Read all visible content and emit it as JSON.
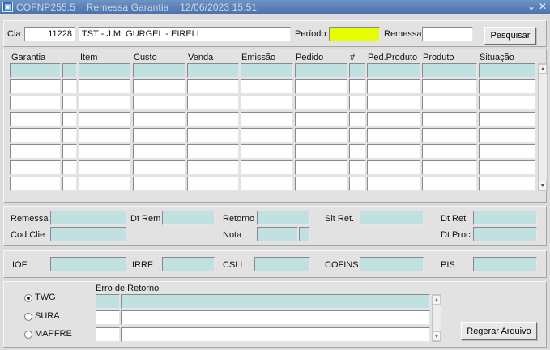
{
  "window": {
    "title": "COFNP255.5    Remessa Garantia    12/06/2023 15:51",
    "minimize_glyph": "⌄",
    "close_glyph": "✕"
  },
  "search": {
    "cia_label": "Cia:",
    "cia_code": "11228",
    "cia_name": "TST - J.M. GURGEL - EIRELI",
    "periodo_label": "Período:",
    "periodo_value": "",
    "remessa_label": "Remessa",
    "remessa_value": "",
    "search_button": "Pesquisar"
  },
  "grid": {
    "columns": [
      "Garantia",
      "Item",
      "Custo",
      "Venda",
      "Emissão",
      "Pedido",
      "#",
      "Ped.Produto",
      "Produto",
      "Situação"
    ],
    "row_count": 8
  },
  "detail": {
    "remessa_label": "Remessa",
    "dt_rem_label": "Dt Rem",
    "retorno_label": "Retorno",
    "sit_ret_label": "Sit Ret.",
    "dt_ret_label": "Dt Ret",
    "cod_clie_label": "Cod Clie",
    "nota_label": "Nota",
    "dt_proc_label": "Dt Proc"
  },
  "taxes": {
    "iof_label": "IOF",
    "irrf_label": "IRRF",
    "csll_label": "CSLL",
    "cofins_label": "COFINS",
    "pis_label": "PIS"
  },
  "bottom": {
    "insurers": [
      {
        "label": "TWG",
        "selected": true
      },
      {
        "label": "SURA",
        "selected": false
      },
      {
        "label": "MAPFRE",
        "selected": false
      }
    ],
    "erro_label": "Erro de Retorno",
    "regerar_button": "Regerar Arquivo"
  },
  "colors": {
    "readonly_fill": "#c1e0e0",
    "highlight_field": "#e5ff00",
    "titlebar": "#5a7fb8"
  }
}
